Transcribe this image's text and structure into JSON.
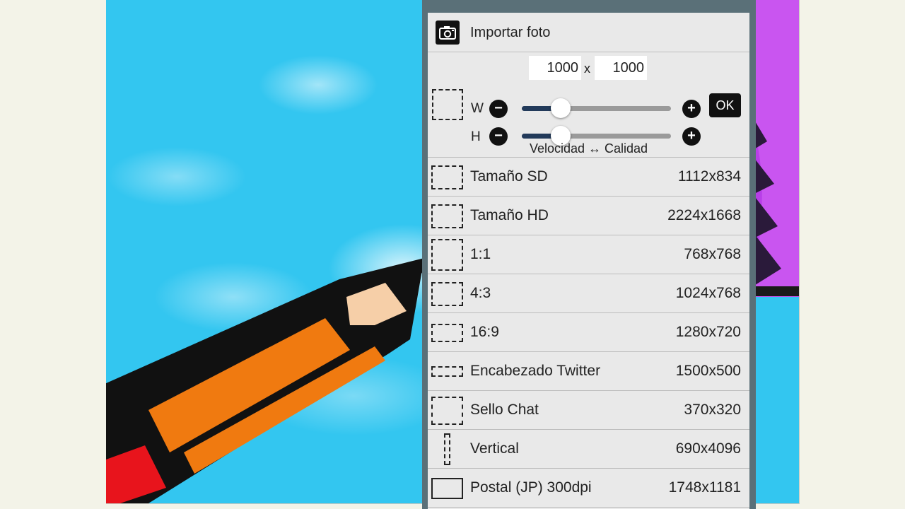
{
  "colors": {
    "sky": "#33c6f0",
    "pencil_orange": "#f07a10",
    "pencil_red": "#e8141c",
    "pencil_tip": "#f6cfa8",
    "purple_art": "#b83ee8",
    "slider_fill": "#223a5a"
  },
  "panel": {
    "import_label": "Importar foto",
    "width_value": "1000",
    "height_value": "1000",
    "times_symbol": "x",
    "w_label": "W",
    "h_label": "H",
    "minus_symbol": "−",
    "plus_symbol": "+",
    "ok_label": "OK",
    "tradeoff_label": "Velocidad ↔ Calidad",
    "w_slider_level": 0.26,
    "h_slider_level": 0.26
  },
  "presets": [
    {
      "name": "Tamaño SD",
      "size": "1112x834"
    },
    {
      "name": "Tamaño HD",
      "size": "2224x1668"
    },
    {
      "name": "1:1",
      "size": "768x768"
    },
    {
      "name": "4:3",
      "size": "1024x768"
    },
    {
      "name": "16:9",
      "size": "1280x720"
    },
    {
      "name": "Encabezado Twitter",
      "size": "1500x500"
    },
    {
      "name": "Sello Chat",
      "size": "370x320"
    },
    {
      "name": "Vertical",
      "size": "690x4096"
    },
    {
      "name": "Postal (JP) 300dpi",
      "size": "1748x1181"
    }
  ]
}
